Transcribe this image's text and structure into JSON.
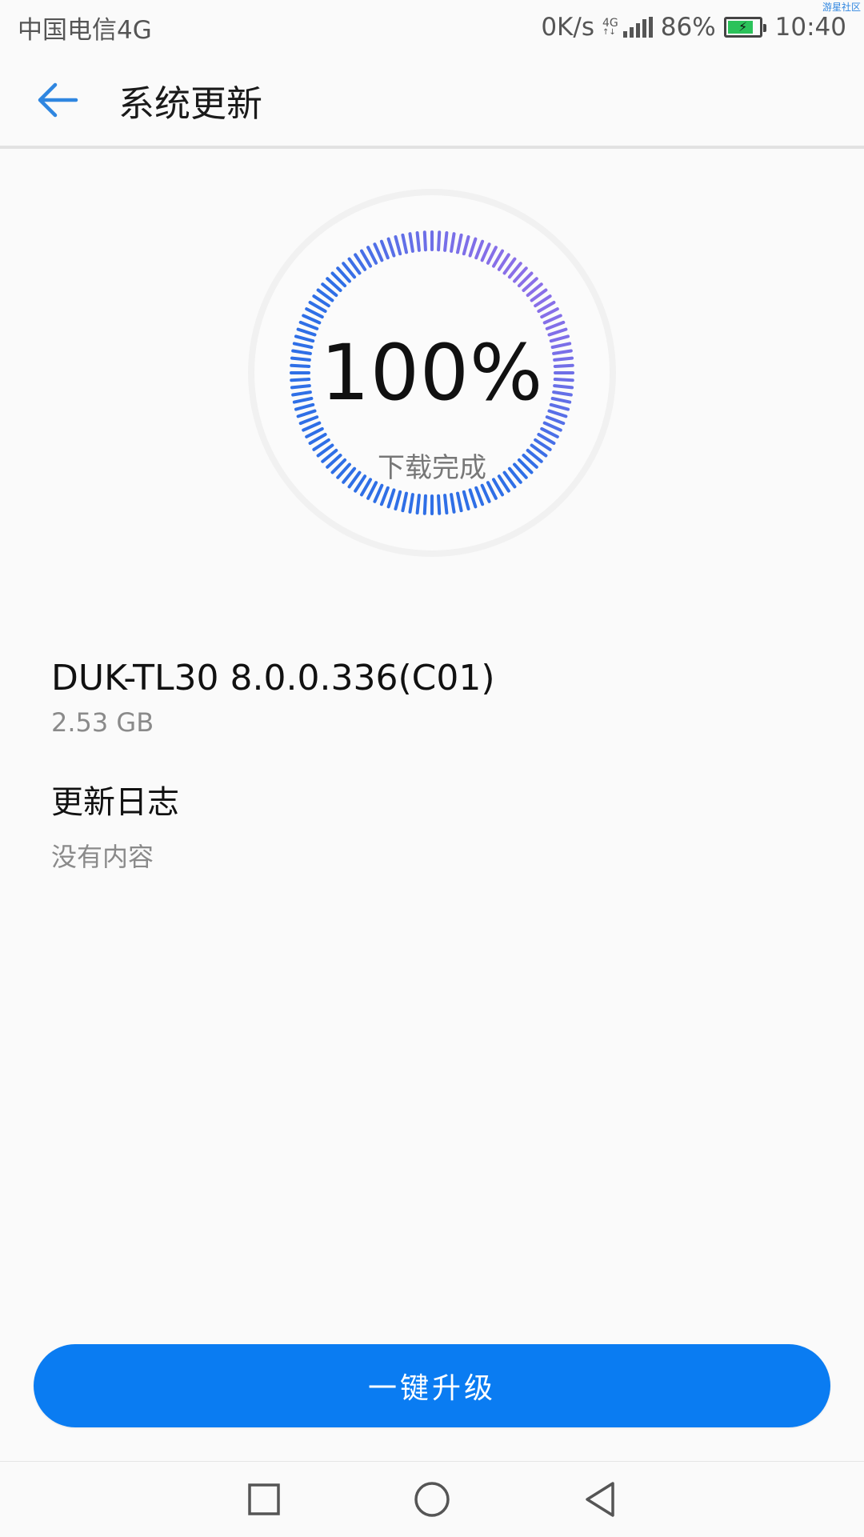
{
  "status_bar": {
    "carrier": "中国电信4G",
    "net_speed": "0K/s",
    "network_type": "4G",
    "battery": "86%",
    "time": "10:40",
    "watermark": "游星社区",
    "battery_level_percent": 86,
    "battery_color": "#2bc25a"
  },
  "app_bar": {
    "title": "系统更新",
    "back_icon": "arrow-left-icon",
    "accent": "#2f86e0"
  },
  "progress": {
    "percent_text": "100%",
    "status": "下载完成",
    "value": 100,
    "gradient_colors": [
      "#2f6fe6",
      "#8a6fe8"
    ]
  },
  "package": {
    "version": "DUK-TL30 8.0.0.336(C01)",
    "size": "2.53 GB"
  },
  "changelog": {
    "title": "更新日志",
    "content": "没有内容"
  },
  "actions": {
    "upgrade_label": "一键升级",
    "button_color": "#0a7cf2"
  },
  "nav_bar": {
    "recents_icon": "square-icon",
    "home_icon": "circle-icon",
    "back_icon": "triangle-back-icon"
  }
}
